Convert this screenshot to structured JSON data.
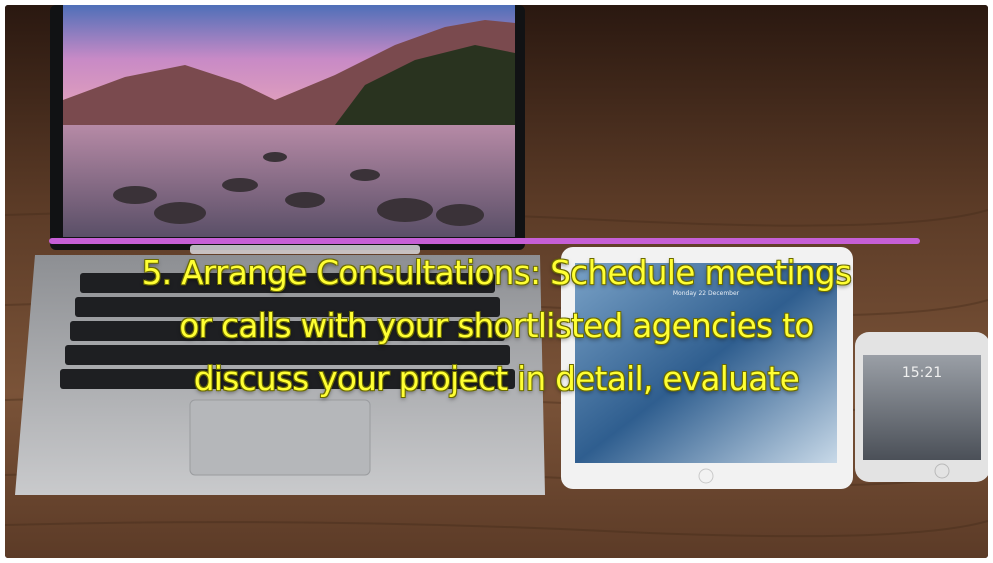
{
  "caption": {
    "lines": [
      "5. Arrange Consultations: Schedule meetings",
      "or calls with your shortlisted agencies to",
      "discuss your project in detail, evaluate"
    ],
    "color": "#ffff33"
  },
  "accent": {
    "rule_color": "#c65fd6"
  },
  "tablet": {
    "date_text": "Monday 22 December"
  },
  "phone": {
    "time_text": "15:21"
  }
}
